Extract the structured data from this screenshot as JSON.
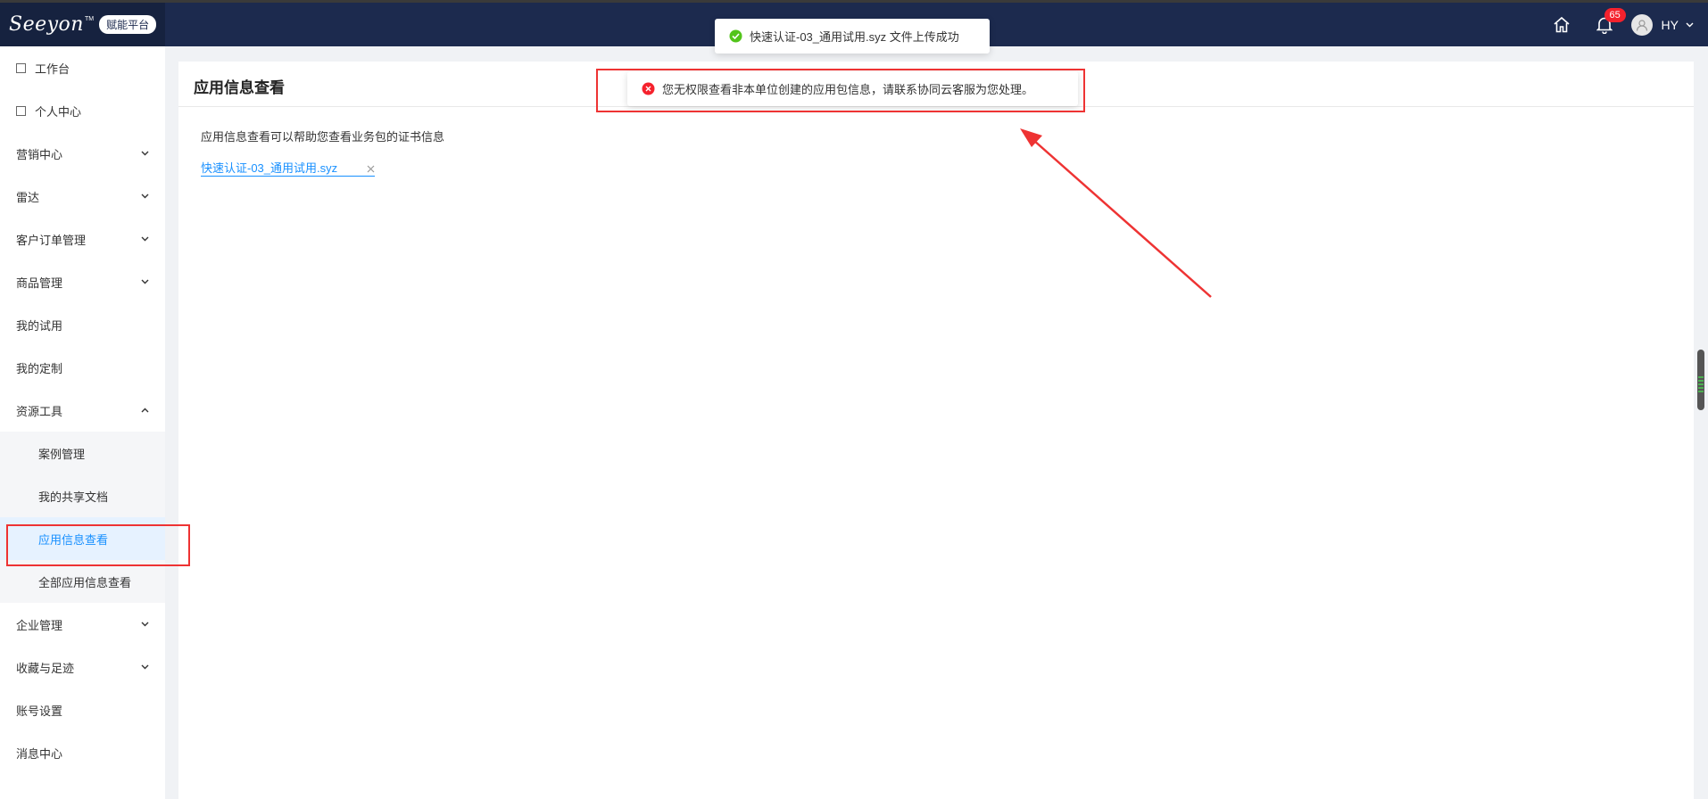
{
  "header": {
    "logo_text": "Seeyon",
    "logo_tm": "TM",
    "platform_badge": "赋能平台",
    "notification_count": "65",
    "username": "HY"
  },
  "sidebar": {
    "items": [
      {
        "label": "工作台"
      },
      {
        "label": "个人中心"
      },
      {
        "label": "营销中心"
      },
      {
        "label": "雷达"
      },
      {
        "label": "客户订单管理"
      },
      {
        "label": "商品管理"
      },
      {
        "label": "我的试用"
      },
      {
        "label": "我的定制"
      },
      {
        "label": "资源工具"
      },
      {
        "label": "案例管理"
      },
      {
        "label": "我的共享文档"
      },
      {
        "label": "应用信息查看"
      },
      {
        "label": "全部应用信息查看"
      },
      {
        "label": "企业管理"
      },
      {
        "label": "收藏与足迹"
      },
      {
        "label": "账号设置"
      },
      {
        "label": "消息中心"
      }
    ]
  },
  "main": {
    "page_title": "应用信息查看",
    "description": "应用信息查看可以帮助您查看业务包的证书信息",
    "uploaded_file": "快速认证-03_通用试用.syz"
  },
  "toasts": {
    "success_text": "快速认证-03_通用试用.syz 文件上传成功",
    "error_text": "您无权限查看非本单位创建的应用包信息，请联系协同云客服为您处理。"
  },
  "colors": {
    "header_bg": "#1c2a4e",
    "accent": "#1890ff",
    "success": "#52c41a",
    "error": "#f5222d",
    "annotation": "#ee3333"
  }
}
